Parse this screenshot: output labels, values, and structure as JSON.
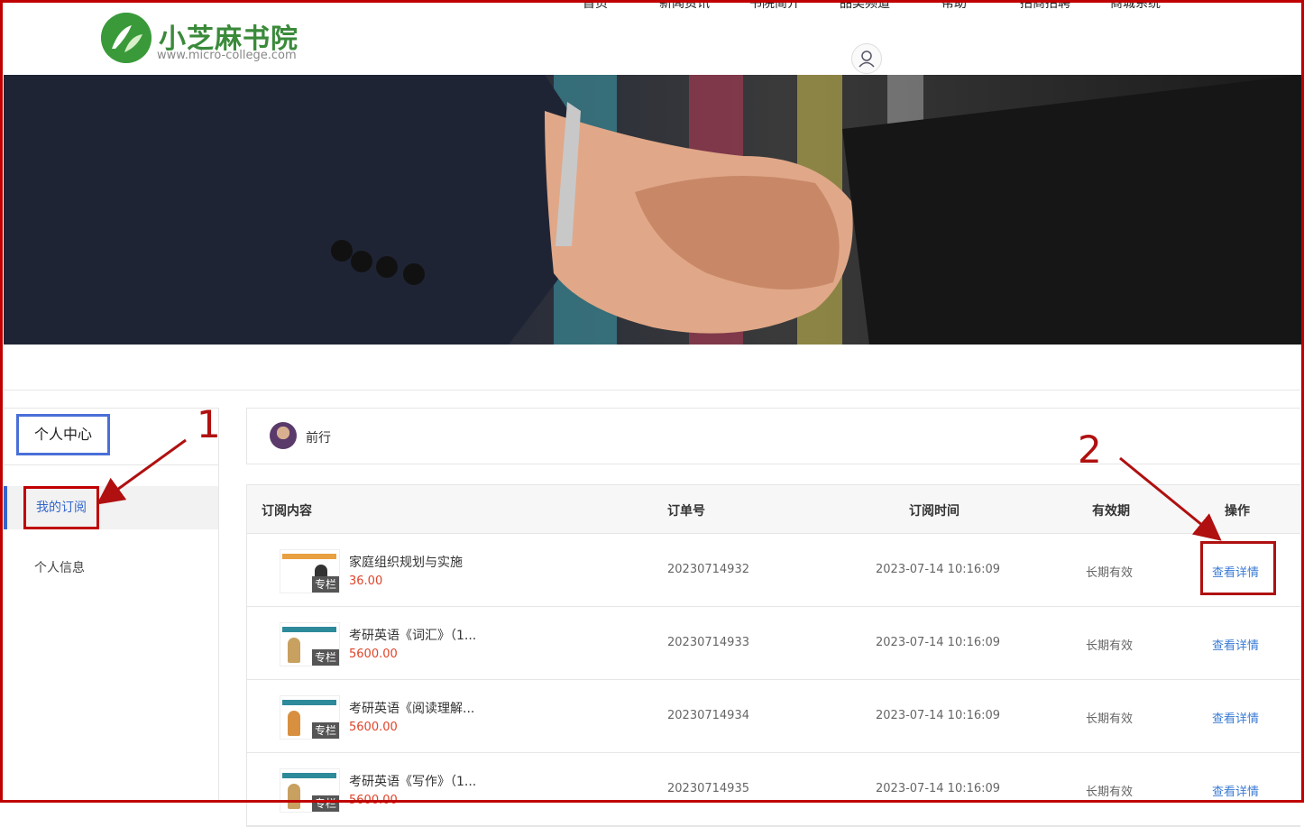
{
  "header": {
    "logo_text": "小芝麻书院",
    "logo_sub": "www.micro-college.com",
    "nav": [
      "首页",
      "新闻资讯",
      "书院简介",
      "品类频道",
      "帮助",
      "招商招聘",
      "商城系统"
    ]
  },
  "sidebar": {
    "title": "个人中心",
    "items": [
      {
        "label": "我的订阅",
        "active": true
      },
      {
        "label": "个人信息",
        "active": false
      }
    ]
  },
  "profile": {
    "username": "前行"
  },
  "table": {
    "headers": [
      "订阅内容",
      "订单号",
      "订阅时间",
      "有效期",
      "操作"
    ],
    "rows": [
      {
        "tag": "专栏",
        "title": "家庭组织规划与实施",
        "price": "36.00",
        "order": "20230714932",
        "time": "2023-07-14 10:16:09",
        "valid": "长期有效",
        "action": "查看详情"
      },
      {
        "tag": "专栏",
        "title": "考研英语《词汇》（1...",
        "price": "5600.00",
        "order": "20230714933",
        "time": "2023-07-14 10:16:09",
        "valid": "长期有效",
        "action": "查看详情"
      },
      {
        "tag": "专栏",
        "title": "考研英语《阅读理解...",
        "price": "5600.00",
        "order": "20230714934",
        "time": "2023-07-14 10:16:09",
        "valid": "长期有效",
        "action": "查看详情"
      },
      {
        "tag": "专栏",
        "title": "考研英语《写作》（1...",
        "price": "5600.00",
        "order": "20230714935",
        "time": "2023-07-14 10:16:09",
        "valid": "长期有效",
        "action": "查看详情"
      }
    ]
  },
  "annotations": {
    "num1": "1",
    "num2": "2"
  },
  "colors": {
    "accent": "#3366cc",
    "annotation": "#b01010",
    "price": "#e0442a",
    "brand": "#3a8a3a"
  }
}
